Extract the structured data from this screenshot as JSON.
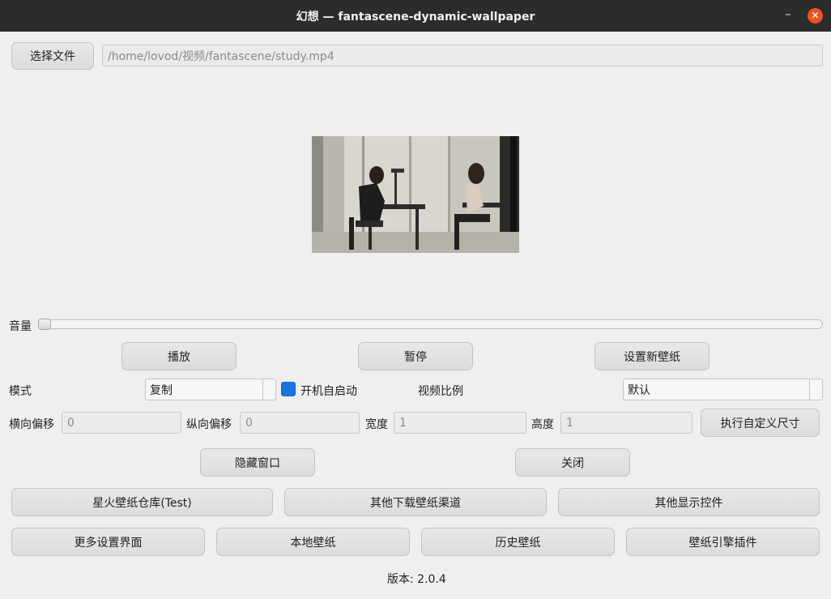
{
  "window": {
    "title": "幻想 — fantascene-dynamic-wallpaper",
    "minimize_label": "–",
    "close_label": "✕"
  },
  "file": {
    "choose_label": "选择文件",
    "path": "/home/lovod/视频/fantascene/study.mp4"
  },
  "preview": {
    "icon": "video-preview-image"
  },
  "volume": {
    "label": "音量",
    "level": 0
  },
  "playback": {
    "play_label": "播放",
    "pause_label": "暂停",
    "set_wallpaper_label": "设置新壁纸"
  },
  "mode": {
    "label": "模式",
    "value": "复制",
    "autostart_label": "开机自启动",
    "autostart_checked": true,
    "ratio_label": "视频比例",
    "ratio_value": "默认"
  },
  "offset": {
    "x_label": "横向偏移",
    "x_placeholder": "0",
    "y_label": "纵向偏移",
    "y_placeholder": "0",
    "width_label": "宽度",
    "width_placeholder": "1",
    "height_label": "高度",
    "height_placeholder": "1",
    "apply_label": "执行自定义尺寸"
  },
  "window_actions": {
    "hide_label": "隐藏窗口",
    "close_label": "关闭"
  },
  "links_row1": [
    "星火壁纸仓库(Test)",
    "其他下载壁纸渠道",
    "其他显示控件"
  ],
  "links_row2": [
    "更多设置界面",
    "本地壁纸",
    "历史壁纸",
    "壁纸引擎插件"
  ],
  "version": {
    "label": "版本:",
    "value": "2.0.4"
  },
  "colors": {
    "titlebar": "#2c2c2c",
    "close_button": "#e95420",
    "checkbox": "#1a73d9",
    "background": "#efefef"
  }
}
